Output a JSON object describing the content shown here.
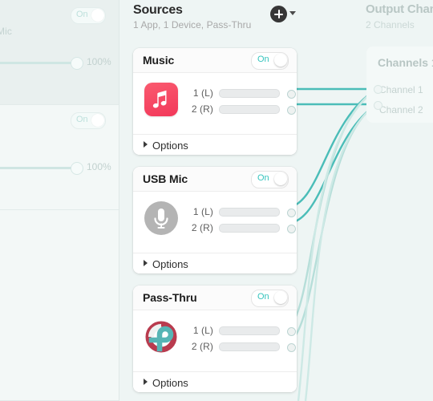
{
  "theme": {
    "bg": "#eef5f4",
    "accent_teal": "#35c4bd",
    "cable": "#4bbdb8",
    "cable_faded": "#b6ded9",
    "card_bg": "#ffffff",
    "text_dark": "#1d1d1d",
    "text_muted": "#a8a8a8"
  },
  "sidebar": {
    "cards": [
      {
        "toggle_label": "On",
        "name": "Mic",
        "volume_label": "100%"
      },
      {
        "toggle_label": "On",
        "name": "",
        "volume_label": "100%"
      }
    ]
  },
  "sources": {
    "title": "Sources",
    "subtitle": "1 App, 1 Device, Pass-Thru",
    "add_button_label": "+",
    "add_button_icon": "plus-circle-icon",
    "add_caret_icon": "chevron-down-icon",
    "cards": [
      {
        "name": "Music",
        "icon": "music-app-icon",
        "toggle_label": "On",
        "toggle_state": "on",
        "channels": [
          {
            "label": "1 (L)",
            "level": 0
          },
          {
            "label": "2 (R)",
            "level": 0
          }
        ],
        "options_label": "Options",
        "options_caret": "chevron-right-icon"
      },
      {
        "name": "USB Mic",
        "icon": "microphone-icon",
        "toggle_label": "On",
        "toggle_state": "on",
        "channels": [
          {
            "label": "1 (L)",
            "level": 0
          },
          {
            "label": "2 (R)",
            "level": 0
          }
        ],
        "options_label": "Options",
        "options_caret": "chevron-right-icon"
      },
      {
        "name": "Pass-Thru",
        "icon": "loopback-passthru-icon",
        "toggle_label": "On",
        "toggle_state": "on",
        "channels": [
          {
            "label": "1 (L)",
            "level": 0
          },
          {
            "label": "2 (R)",
            "level": 0
          }
        ],
        "options_label": "Options",
        "options_caret": "chevron-right-icon"
      }
    ]
  },
  "output": {
    "title": "Output Chan",
    "subtitle": "2 Channels",
    "card": {
      "title": "Channels 1",
      "rows": [
        {
          "label": "Channel 1"
        },
        {
          "label": "Channel 2"
        }
      ]
    }
  }
}
